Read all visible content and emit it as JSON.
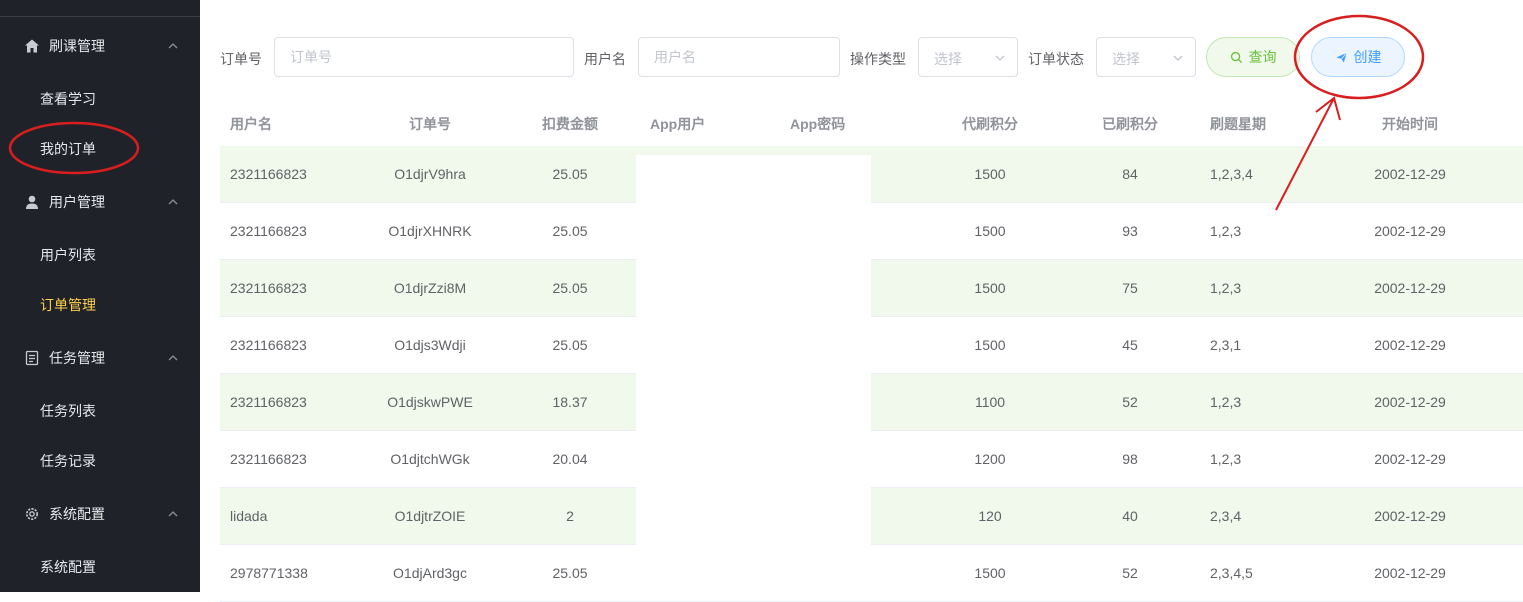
{
  "sidebar": {
    "groups": [
      {
        "label": "刷课管理",
        "icon": "home-icon",
        "items": [
          "查看学习",
          "我的订单"
        ]
      },
      {
        "label": "用户管理",
        "icon": "user-icon",
        "items": [
          "用户列表",
          "订单管理"
        ]
      },
      {
        "label": "任务管理",
        "icon": "document-icon",
        "items": [
          "任务列表",
          "任务记录"
        ]
      },
      {
        "label": "系统配置",
        "icon": "gear-icon",
        "items": [
          "系统配置"
        ]
      }
    ],
    "active_item": "订单管理",
    "highlighted_item": "我的订单"
  },
  "filters": {
    "order_no_label": "订单号",
    "order_no_placeholder": "订单号",
    "username_label": "用户名",
    "username_placeholder": "用户名",
    "op_type_label": "操作类型",
    "op_type_placeholder": "选择",
    "status_label": "订单状态",
    "status_placeholder": "选择",
    "query_label": "查询",
    "create_label": "创建"
  },
  "table": {
    "columns": [
      "用户名",
      "订单号",
      "扣费金额",
      "App用户",
      "App密码",
      "代刷积分",
      "已刷积分",
      "刷题星期",
      "开始时间"
    ],
    "rows": [
      {
        "user": "2321166823",
        "order": "O1djrV9hra",
        "amount": "25.05",
        "points": "1500",
        "done": "84",
        "week": "1,2,3,4",
        "start": "2002-12-29"
      },
      {
        "user": "2321166823",
        "order": "O1djrXHNRK",
        "amount": "25.05",
        "points": "1500",
        "done": "93",
        "week": "1,2,3",
        "start": "2002-12-29"
      },
      {
        "user": "2321166823",
        "order": "O1djrZzi8M",
        "amount": "25.05",
        "points": "1500",
        "done": "75",
        "week": "1,2,3",
        "start": "2002-12-29"
      },
      {
        "user": "2321166823",
        "order": "O1djs3Wdji",
        "amount": "25.05",
        "points": "1500",
        "done": "45",
        "week": "2,3,1",
        "start": "2002-12-29"
      },
      {
        "user": "2321166823",
        "order": "O1djskwPWE",
        "amount": "18.37",
        "points": "1100",
        "done": "52",
        "week": "1,2,3",
        "start": "2002-12-29"
      },
      {
        "user": "2321166823",
        "order": "O1djtchWGk",
        "amount": "20.04",
        "points": "1200",
        "done": "98",
        "week": "1,2,3",
        "start": "2002-12-29"
      },
      {
        "user": "lidada",
        "order": "O1djtrZOIE",
        "amount": "2",
        "points": "120",
        "done": "40",
        "week": "2,3,4",
        "start": "2002-12-29"
      },
      {
        "user": "2978771338",
        "order": "O1djArd3gc",
        "amount": "25.05",
        "points": "1500",
        "done": "52",
        "week": "2,3,4,5",
        "start": "2002-12-29"
      }
    ]
  },
  "colors": {
    "sidebar_bg": "#1f2329",
    "active_text": "#ffd04b",
    "stripe_bg": "#f0f9eb",
    "annotation": "#d81e1e"
  }
}
